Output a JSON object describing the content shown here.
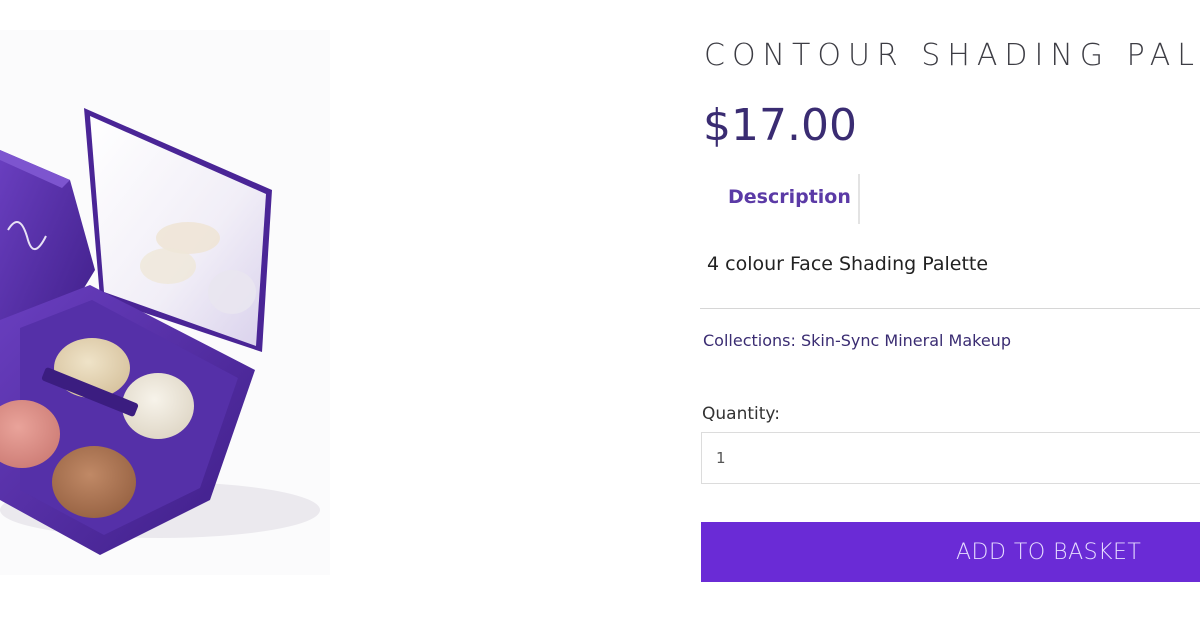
{
  "product": {
    "title": "CONTOUR SHADING PALETTE",
    "price": "$17.00",
    "tab_description": "Description",
    "description_text": "4 colour Face Shading Palette",
    "collections_text": "Collections: Skin-Sync Mineral Makeup",
    "quantity_label": "Quantity:",
    "quantity_value": "1",
    "add_to_basket_label": "ADD TO BASKET"
  },
  "colors": {
    "accent": "#6a2bd6",
    "price": "#3a2c72",
    "tab": "#5b3aa6",
    "palette_case": "#5b2fa8"
  },
  "image": {
    "subject": "purple four-pan contour shading palette with open mirror lid"
  }
}
